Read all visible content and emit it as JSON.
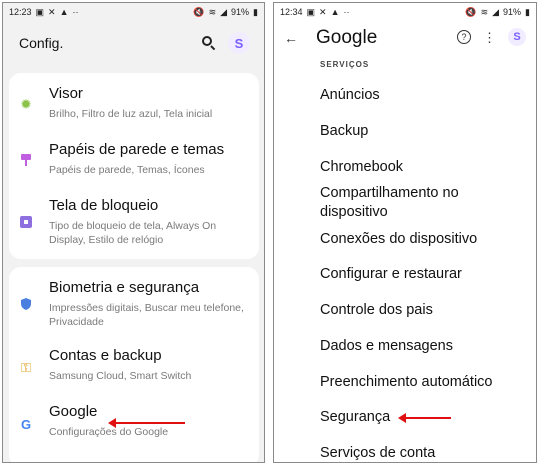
{
  "left": {
    "status": {
      "time": "12:23",
      "battery": "91%"
    },
    "title": "Config.",
    "badge": "S",
    "items": [
      {
        "title": "Visor",
        "subtitle": "Brilho, Filtro de luz azul, Tela inicial",
        "icon": "sun-icon",
        "color": "#8bc34a"
      },
      {
        "title": "Papéis de parede e temas",
        "subtitle": "Papéis de parede, Temas, Ícones",
        "icon": "paintbrush-icon",
        "color": "#c060e0"
      },
      {
        "title": "Tela de bloqueio",
        "subtitle": "Tipo de bloqueio de tela, Always On Display, Estilo de relógio",
        "icon": "lock-icon",
        "color": "#8e6fe0"
      },
      {
        "title": "Biometria e segurança",
        "subtitle": "Impressões digitais, Buscar meu telefone, Privacidade",
        "icon": "shield-icon",
        "color": "#4a7fe0"
      },
      {
        "title": "Contas e backup",
        "subtitle": "Samsung Cloud, Smart Switch",
        "icon": "key-icon",
        "color": "#e0a020"
      },
      {
        "title": "Google",
        "subtitle": "Configurações do Google",
        "icon": "google-icon",
        "color": "#4285f4"
      }
    ]
  },
  "right": {
    "status": {
      "time": "12:34",
      "battery": "91%"
    },
    "title": "Google",
    "badge": "S",
    "section": "SERVIÇOS",
    "items": [
      "Anúncios",
      "Backup",
      "Chromebook",
      "Compartilhamento no dispositivo",
      "Conexões do dispositivo",
      "Configurar e restaurar",
      "Controle dos pais",
      "Dados e mensagens",
      "Preenchimento automático",
      "Segurança",
      "Serviços de conta"
    ]
  },
  "colors": {
    "annotation_arrow": "#e01010",
    "accent": "#7a5cff"
  }
}
